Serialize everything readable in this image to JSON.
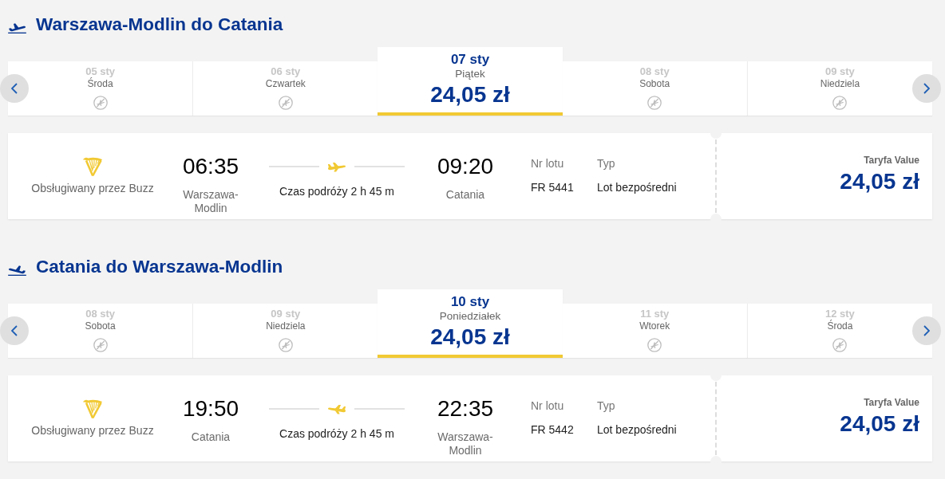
{
  "journeys": [
    {
      "kind": "outbound",
      "heading": "Warszawa-Modlin do Catania",
      "dates": [
        {
          "date": "05 sty",
          "weekday": "Środa",
          "selected": false
        },
        {
          "date": "06 sty",
          "weekday": "Czwartek",
          "selected": false
        },
        {
          "date": "07 sty",
          "weekday": "Piątek",
          "selected": true,
          "price": "24,05 zł"
        },
        {
          "date": "08 sty",
          "weekday": "Sobota",
          "selected": false
        },
        {
          "date": "09 sty",
          "weekday": "Niedziela",
          "selected": false
        }
      ],
      "flight": {
        "operator": "Obsługiwany przez Buzz",
        "departure_time": "06:35",
        "departure_city": "Warszawa-Modlin",
        "duration": "Czas podróży 2 h 45 m",
        "arrival_time": "09:20",
        "arrival_city": "Catania",
        "flight_number_label": "Nr lotu",
        "flight_number": "FR 5441",
        "type_label": "Typ",
        "type": "Lot bezpośredni",
        "fare_name": "Taryfa Value",
        "fare_price": "24,05 zł"
      }
    },
    {
      "kind": "inbound",
      "heading": "Catania do Warszawa-Modlin",
      "dates": [
        {
          "date": "08 sty",
          "weekday": "Sobota",
          "selected": false
        },
        {
          "date": "09 sty",
          "weekday": "Niedziela",
          "selected": false
        },
        {
          "date": "10 sty",
          "weekday": "Poniedziałek",
          "selected": true,
          "price": "24,05 zł"
        },
        {
          "date": "11 sty",
          "weekday": "Wtorek",
          "selected": false
        },
        {
          "date": "12 sty",
          "weekday": "Środa",
          "selected": false
        }
      ],
      "flight": {
        "operator": "Obsługiwany przez Buzz",
        "departure_time": "19:50",
        "departure_city": "Catania",
        "duration": "Czas podróży 2 h 45 m",
        "arrival_time": "22:35",
        "arrival_city": "Warszawa-Modlin",
        "flight_number_label": "Nr lotu",
        "flight_number": "FR 5442",
        "type_label": "Typ",
        "type": "Lot bezpośredni",
        "fare_name": "Taryfa Value",
        "fare_price": "24,05 zł"
      }
    }
  ]
}
